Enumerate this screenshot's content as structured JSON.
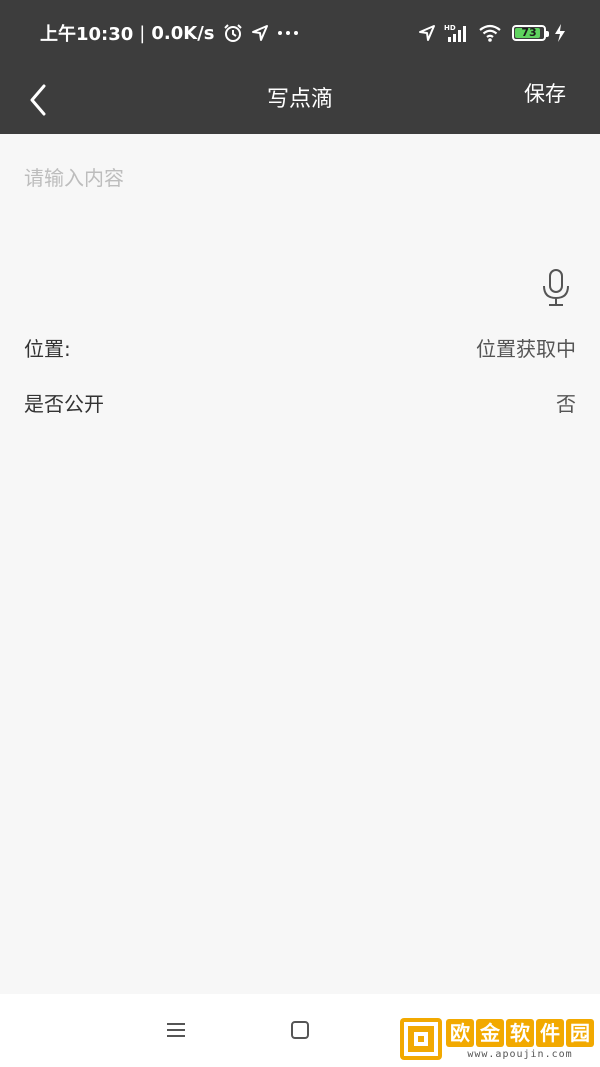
{
  "status_bar": {
    "time": "上午10:30",
    "separator": "|",
    "net_speed": "0.0K/s",
    "battery_level": "73",
    "icons": [
      "alarm-icon",
      "location-arrow-icon",
      "more-dots-icon",
      "location-arrow-icon",
      "hd-signal-icon",
      "wifi-icon",
      "battery-icon",
      "charging-bolt-icon"
    ],
    "battery_color": "#5fd35f"
  },
  "header": {
    "back_icon": "chevron-left-icon",
    "title": "写点滴",
    "save_label": "保存",
    "background": "#3d3d3d"
  },
  "editor": {
    "placeholder": "请输入内容",
    "value": "",
    "mic_icon": "microphone-icon"
  },
  "fields": {
    "location_label": "位置:",
    "location_value": "位置获取中",
    "public_label": "是否公开",
    "public_value": "否"
  },
  "nav_bar": {
    "icons": [
      "menu-icon",
      "home-square-icon",
      "back-icon"
    ]
  },
  "watermark": {
    "chars": [
      "欧",
      "金",
      "软",
      "件",
      "园"
    ],
    "url": "www.apoujin.com",
    "color": "#f2a900"
  }
}
